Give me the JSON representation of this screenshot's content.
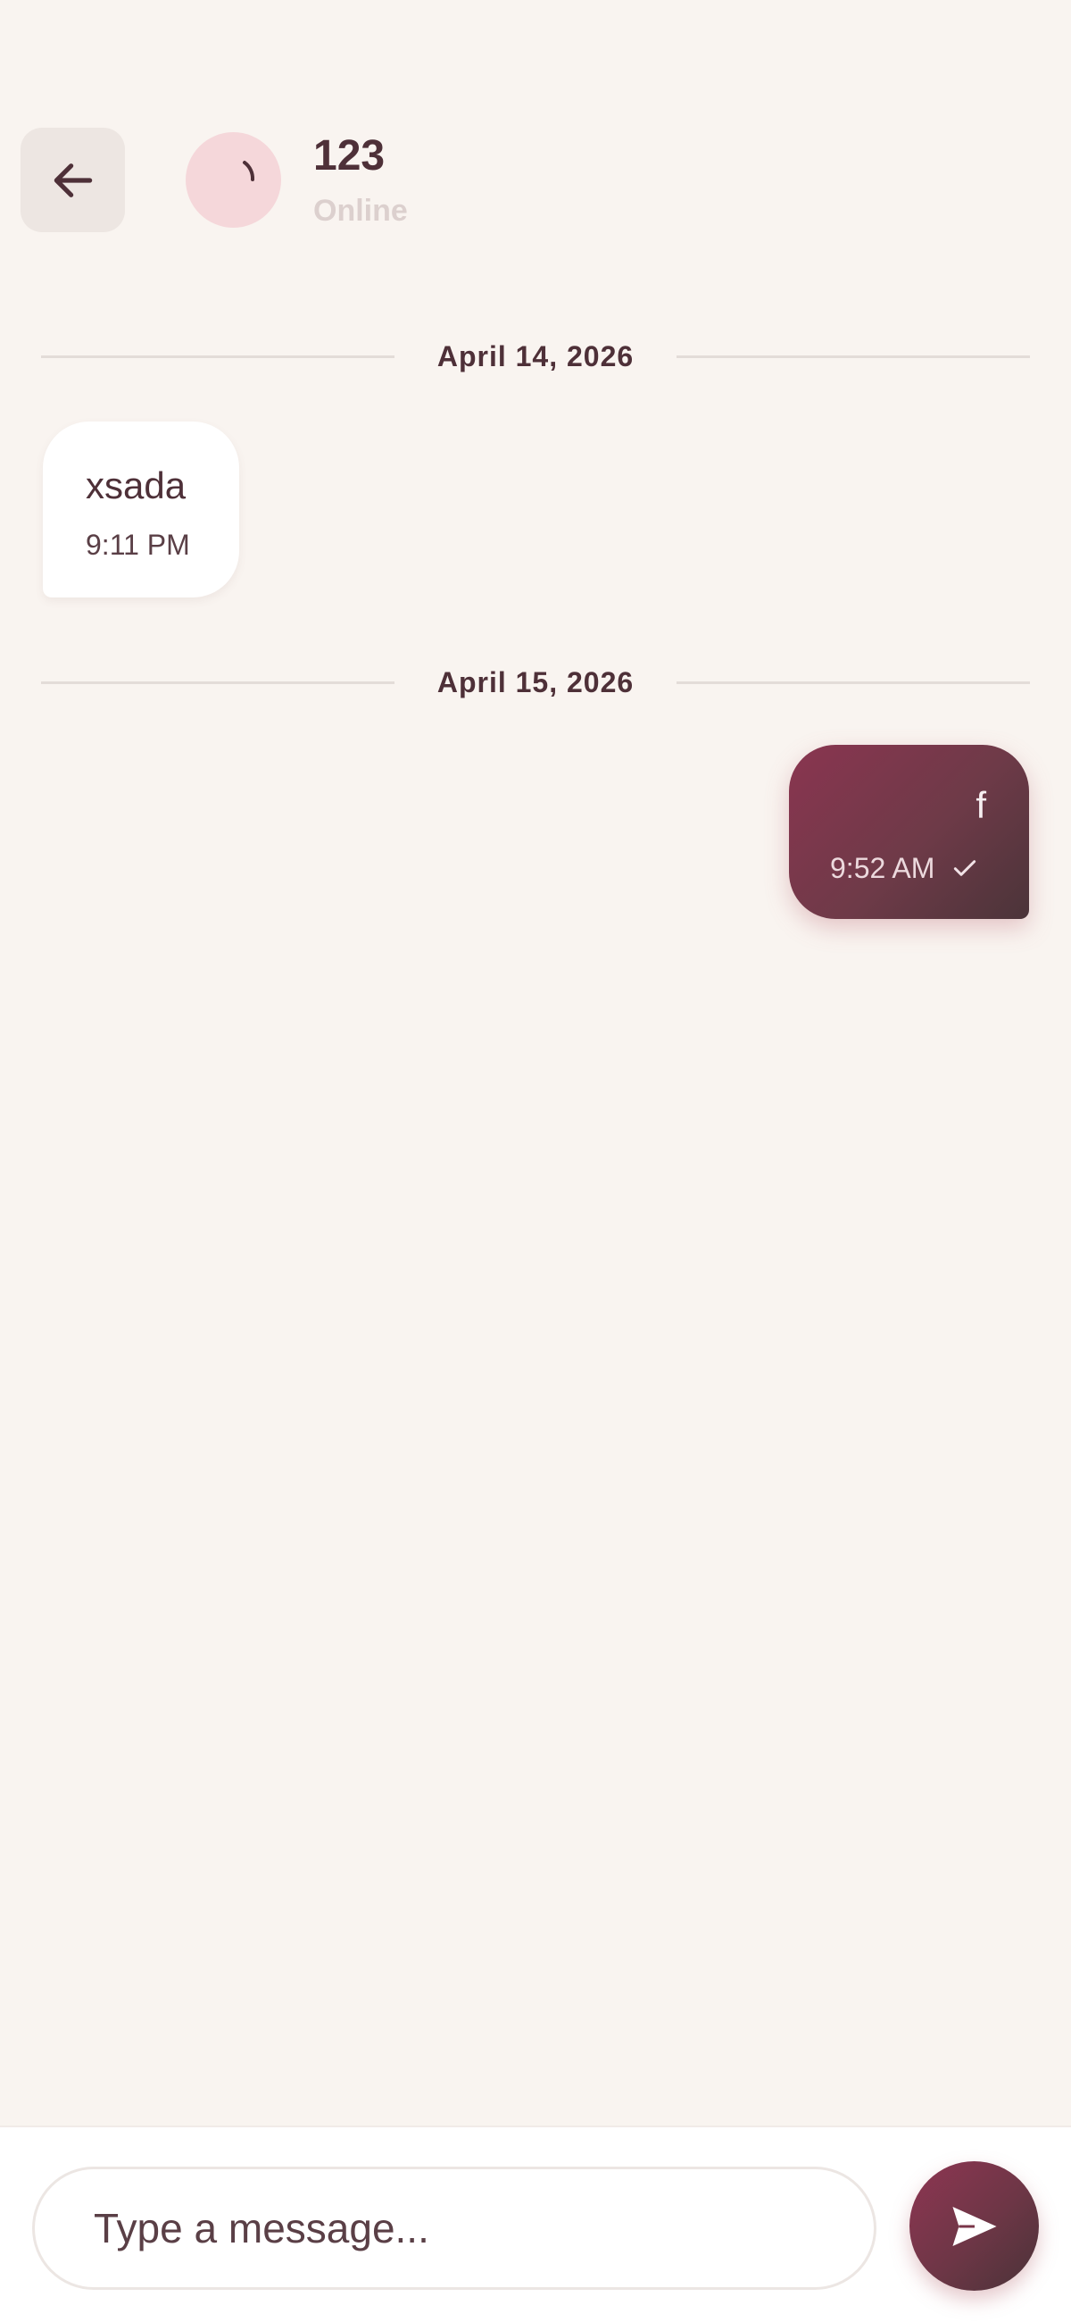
{
  "header": {
    "back_icon": "arrow-left-icon",
    "contact_name": "123",
    "status": "Online"
  },
  "conversation": {
    "groups": [
      {
        "date": "April 14, 2026",
        "messages": [
          {
            "direction": "incoming",
            "text": "xsada",
            "time": "9:11 PM"
          }
        ]
      },
      {
        "date": "April 15, 2026",
        "messages": [
          {
            "direction": "outgoing",
            "text": "f",
            "time": "9:52 AM",
            "status_icon": "check-icon"
          }
        ]
      }
    ]
  },
  "composer": {
    "placeholder": "Type a message...",
    "send_icon": "send-icon"
  },
  "colors": {
    "background": "#f9f4f0",
    "accent": "#8a3550",
    "accent_dark": "#4b3439",
    "text": "#4e3038",
    "avatar": "#f5d7da"
  }
}
